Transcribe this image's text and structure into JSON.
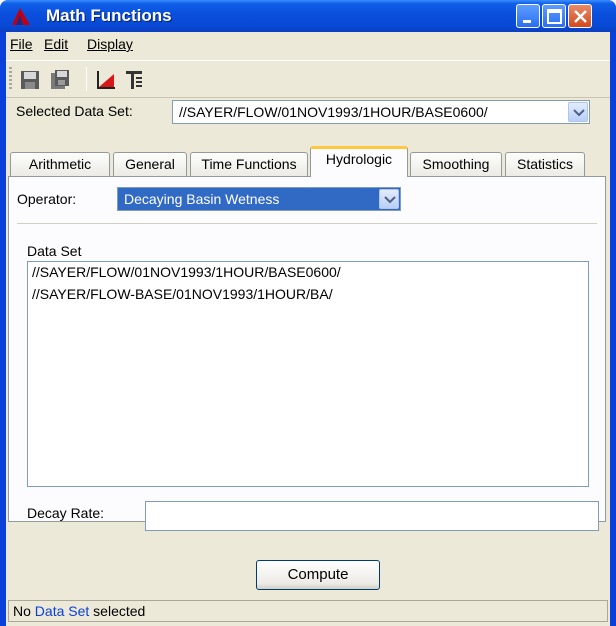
{
  "window": {
    "title": "Math Functions",
    "accent": "#0a3fd9"
  },
  "menubar": {
    "items": [
      {
        "label": "File"
      },
      {
        "label": "Edit"
      },
      {
        "label": "Display"
      }
    ]
  },
  "toolbar": {
    "buttons": [
      {
        "icon": "save-icon"
      },
      {
        "icon": "save-as-icon"
      },
      {
        "icon": "plot-icon"
      },
      {
        "icon": "tabulate-icon"
      }
    ]
  },
  "selected_data_set": {
    "label": "Selected Data Set:",
    "value": "//SAYER/FLOW/01NOV1993/1HOUR/BASE0600/"
  },
  "tabs": [
    {
      "label": "Arithmetic"
    },
    {
      "label": "General"
    },
    {
      "label": "Time Functions"
    },
    {
      "label": "Hydrologic",
      "active": true
    },
    {
      "label": "Smoothing"
    },
    {
      "label": "Statistics"
    }
  ],
  "operator": {
    "label": "Operator:",
    "value": "Decaying Basin Wetness"
  },
  "data_set": {
    "label": "Data Set",
    "items": [
      "//SAYER/FLOW/01NOV1993/1HOUR/BASE0600/",
      "//SAYER/FLOW-BASE/01NOV1993/1HOUR/BA/"
    ]
  },
  "decay_rate": {
    "label": "Decay Rate:",
    "value": ""
  },
  "compute_button": {
    "label": "Compute"
  },
  "status": {
    "prefix": "No ",
    "highlight": "Data Set",
    "suffix": " selected"
  }
}
